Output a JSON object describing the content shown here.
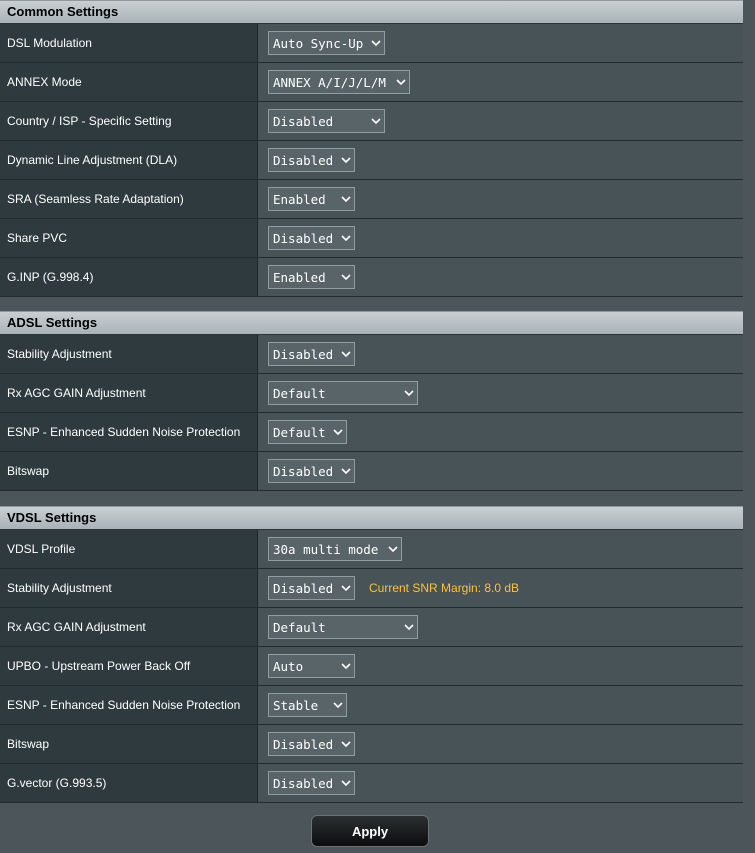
{
  "common": {
    "title": "Common Settings",
    "rows": [
      {
        "label": "DSL Modulation",
        "value": "Auto Sync-Up"
      },
      {
        "label": "ANNEX Mode",
        "value": "ANNEX A/I/J/L/M"
      },
      {
        "label": "Country / ISP - Specific Setting",
        "value": "Disabled"
      },
      {
        "label": "Dynamic Line Adjustment (DLA)",
        "value": "Disabled"
      },
      {
        "label": "SRA (Seamless Rate Adaptation)",
        "value": "Enabled"
      },
      {
        "label": "Share PVC",
        "value": "Disabled"
      },
      {
        "label": "G.INP (G.998.4)",
        "value": "Enabled"
      }
    ]
  },
  "adsl": {
    "title": "ADSL Settings",
    "rows": [
      {
        "label": "Stability Adjustment",
        "value": "Disabled"
      },
      {
        "label": "Rx AGC GAIN Adjustment",
        "value": "Default"
      },
      {
        "label": "ESNP - Enhanced Sudden Noise Protection",
        "value": "Default"
      },
      {
        "label": "Bitswap",
        "value": "Disabled"
      }
    ]
  },
  "vdsl": {
    "title": "VDSL Settings",
    "rows": [
      {
        "label": "VDSL Profile",
        "value": "30a multi mode"
      },
      {
        "label": "Stability Adjustment",
        "value": "Disabled",
        "note": "Current SNR Margin: 8.0 dB"
      },
      {
        "label": "Rx AGC GAIN Adjustment",
        "value": "Default"
      },
      {
        "label": "UPBO - Upstream Power Back Off",
        "value": "Auto"
      },
      {
        "label": "ESNP - Enhanced Sudden Noise Protection",
        "value": "Stable"
      },
      {
        "label": "Bitswap",
        "value": "Disabled"
      },
      {
        "label": "G.vector (G.993.5)",
        "value": "Disabled"
      }
    ]
  },
  "apply_label": "Apply",
  "colors": {
    "accent_note": "#fdc232",
    "header_bg": "#b7bfc3",
    "label_bg": "#2f3a3e",
    "value_bg": "#475357"
  },
  "icons": {
    "dropdown": "chevron-down-icon"
  }
}
